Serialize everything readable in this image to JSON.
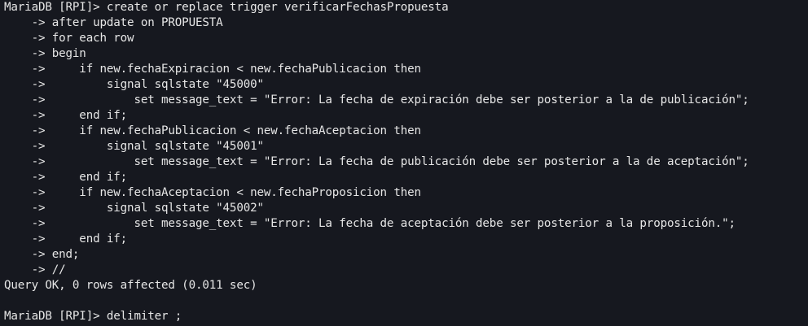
{
  "terminal": {
    "background": "#16181f",
    "foreground": "#e6e6e6",
    "lines": [
      "MariaDB [RPI]> create or replace trigger verificarFechasPropuesta",
      "    -> after update on PROPUESTA",
      "    -> for each row",
      "    -> begin",
      "    ->     if new.fechaExpiracion < new.fechaPublicacion then",
      "    ->         signal sqlstate \"45000\"",
      "    ->             set message_text = \"Error: La fecha de expiración debe ser posterior a la de publicación\";",
      "    ->     end if;",
      "    ->     if new.fechaPublicacion < new.fechaAceptacion then",
      "    ->         signal sqlstate \"45001\"",
      "    ->             set message_text = \"Error: La fecha de publicación debe ser posterior a la de aceptación\";",
      "    ->     end if;",
      "    ->     if new.fechaAceptacion < new.fechaProposicion then",
      "    ->         signal sqlstate \"45002\"",
      "    ->             set message_text = \"Error: La fecha de aceptación debe ser posterior a la proposición.\";",
      "    ->     end if;",
      "    -> end;",
      "    -> //",
      "Query OK, 0 rows affected (0.011 sec)",
      "",
      "MariaDB [RPI]> delimiter ;"
    ]
  }
}
